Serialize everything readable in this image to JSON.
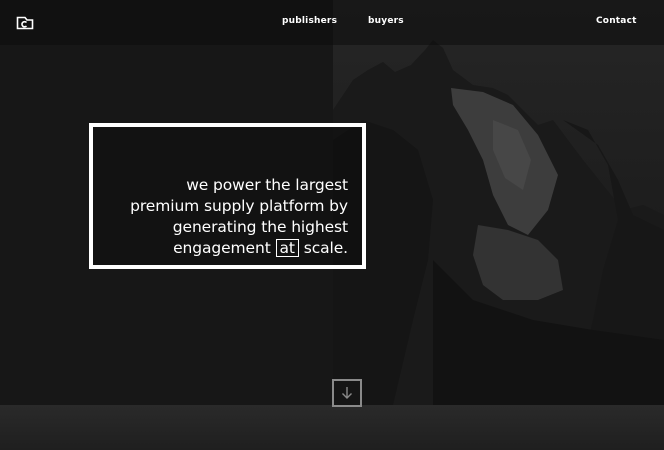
{
  "header": {
    "logo_icon": "logo-c-icon",
    "nav": [
      {
        "label": "publishers"
      },
      {
        "label": "buyers"
      },
      {
        "label": "Contact"
      }
    ]
  },
  "hero": {
    "lines": [
      "we power the largest",
      "premium supply platform by",
      "generating the highest"
    ],
    "last_line_prefix": "engagement",
    "last_line_highlight": "at",
    "last_line_suffix": "scale."
  },
  "scroll": {
    "icon": "arrow-down-icon"
  },
  "colors": {
    "background": "#171717",
    "text": "#ffffff",
    "scroll_border": "#8a8a8a"
  }
}
